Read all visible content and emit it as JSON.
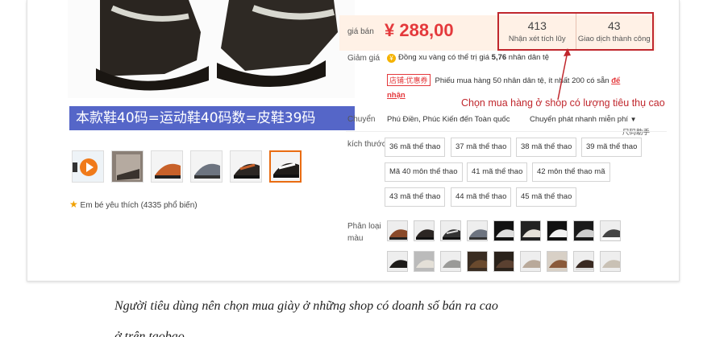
{
  "banner": "本款鞋40码=运动鞋40码数=皮鞋39码",
  "favorite": {
    "icon": "star-icon",
    "text": "Em bé yêu thích (4335 phổ biến)"
  },
  "price": {
    "label": "giá bán",
    "value": "¥ 288,00"
  },
  "stats": [
    {
      "num": "413",
      "caption": "Nhận xét tích lũy"
    },
    {
      "num": "43",
      "caption": "Giao dịch thành công"
    }
  ],
  "discount": {
    "label": "Giảm giá",
    "coin_icon": "coin-icon",
    "coin_text_pre": "Đồng xu vàng có thể trị giá ",
    "coin_value": "5,76",
    "coin_text_post": " nhân dân tệ",
    "tag": "店铺:优惠券",
    "coupon_text": "Phiếu mua hàng 50 nhân dân tệ, ít nhất 200 có sẵn",
    "coupon_link_1": "để",
    "coupon_link_2": "nhận"
  },
  "annotation": "Chọn mua hàng ở shop có lượng tiêu thụ cao",
  "shipping": {
    "label": "Chuyển",
    "route": "Phú Điền, Phúc Kiến đến Toàn quốc",
    "method": "Chuyển phát nhanh miễn phí",
    "size_helper": "尺码助手"
  },
  "sizes": {
    "label": "kích thước",
    "options": [
      "36 mã thể thao",
      "37 mã thể thao",
      "38 mã thể thao",
      "39 mã thể thao",
      "Mã 40 môn thể thao",
      "41 mã thể thao",
      "42 môn thể thao mã",
      "43 mã thể thao",
      "44 mã thể thao",
      "45 mã thể thao"
    ]
  },
  "variants": {
    "label_1": "Phân loại",
    "label_2": "màu"
  },
  "caption": "Người tiêu dùng nên chọn mua giày ở những shop có doanh số bán ra cao",
  "caption_cont": "ở trên taobao"
}
